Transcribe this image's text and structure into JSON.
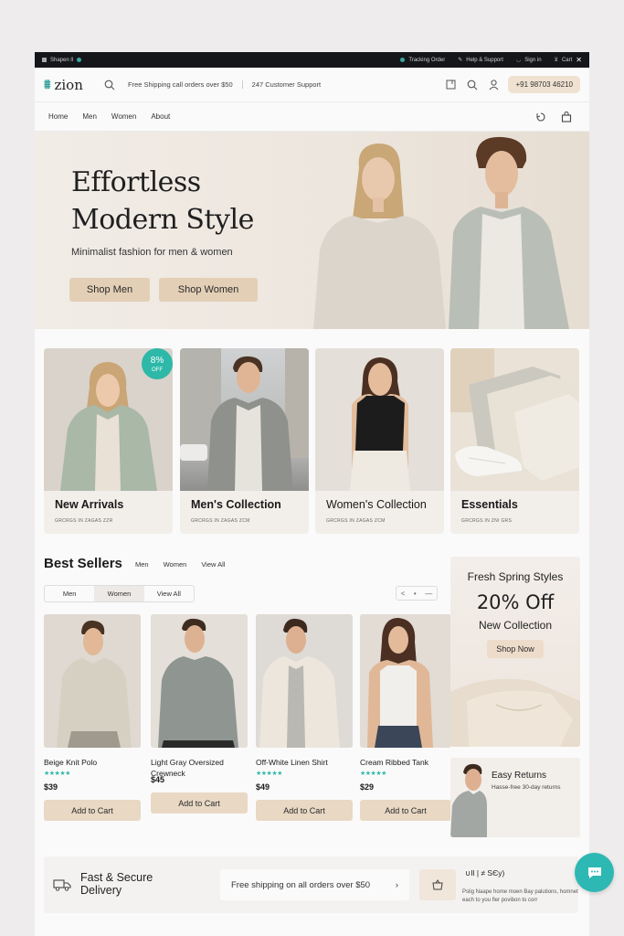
{
  "topbar": {
    "left_text": "Shapen ll",
    "items": [
      "Tracking Order",
      "Help & Support",
      "Sign in",
      "Cart"
    ]
  },
  "header": {
    "logo": "zion",
    "shipping_text": "Free Shipping call orders over $50",
    "support_text": "247 Customer Support",
    "phone": "+91 98703 46210"
  },
  "nav": {
    "items": [
      "Home",
      "Men",
      "Women",
      "About"
    ]
  },
  "hero": {
    "title_line1": "Effortless",
    "title_line2": "Modern Style",
    "subtitle": "Minimalist fashion for men & women",
    "btn_men": "Shop Men",
    "btn_women": "Shop Women"
  },
  "categories": [
    {
      "title": "New Arrivals",
      "meta": "GRCRGS IN ZAGAS ZZR",
      "badge_value": "8%",
      "badge_label": "OFF"
    },
    {
      "title": "Men's Collection",
      "meta": "GRCRGS IN ZAGAS ZCM"
    },
    {
      "title": "Women's Collection",
      "meta": "GRCRGS IN ZAGAS ZCM"
    },
    {
      "title": "Essentials",
      "meta": "GRCRGS IN ZNI GRS"
    }
  ],
  "best_sellers": {
    "title": "Best Sellers",
    "links": [
      "Men",
      "Women",
      "View All"
    ],
    "tabs": [
      "Men",
      "Women",
      "View All"
    ],
    "pager": [
      "<",
      "•",
      "—"
    ],
    "products": [
      {
        "name": "Beige Knit Polo",
        "stars": "★★★★★",
        "price": "$39",
        "cart": "Add to Cart",
        "rating": 5
      },
      {
        "name": "Light Gray Oversized Crewneck",
        "stars": "",
        "price": "$45",
        "cart": "Add to Cart",
        "rating": 0
      },
      {
        "name": "Off-White Linen Shirt",
        "stars": "★★★★★",
        "price": "$49",
        "cart": "Add to Cart",
        "rating": 5
      },
      {
        "name": "Cream Ribbed Tank",
        "stars": "★★★★★",
        "price": "$29",
        "cart": "Add to Cart",
        "rating": 5
      }
    ]
  },
  "promo": {
    "line1": "Fresh Spring Styles",
    "line2": "20% Off",
    "line3": "New Collection",
    "button": "Shop Now"
  },
  "returns": {
    "title": "Easy Returns",
    "subtitle": "Hasse-free 30-day returns"
  },
  "delivery": {
    "title_line1": "Fast & Secure",
    "title_line2": "Delivery",
    "shipping": "Free shipping on all orders over $50",
    "info_title": "∪Il | ≠ SЄy)",
    "info_body": "Pslig Naape home moen Bay palutions, homnet each to you fler povibon to corr"
  },
  "colors": {
    "accent": "#2eb8a8",
    "button_beige": "#e3cfb6",
    "topbar": "#15161a"
  }
}
